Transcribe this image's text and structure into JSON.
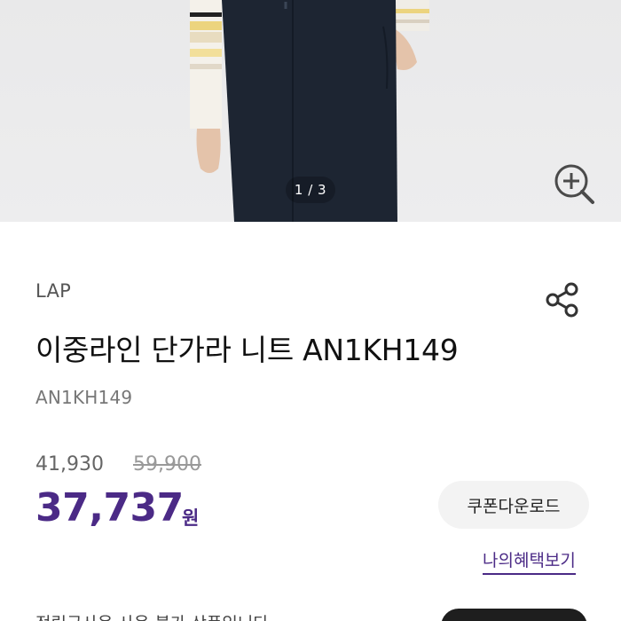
{
  "gallery": {
    "indicator": "1 / 3",
    "current_page": 1,
    "total_pages": 3,
    "zoom_icon": "zoom-in-icon"
  },
  "product": {
    "brand": "LAP",
    "share_icon": "share-icon",
    "title": "이중라인 단가라 니트 AN1KH149",
    "code": "AN1KH149"
  },
  "price": {
    "original": "41,930",
    "list": "59,900",
    "sale": "37,737",
    "unit": "원"
  },
  "actions": {
    "coupon_label": "쿠폰다운로드",
    "benefits_label": "나의혜택보기"
  },
  "bottom": {
    "note": "적립금사용 사용 불가 상품입니다"
  },
  "colors": {
    "accent": "#4b2a86",
    "pants": "#1d2532",
    "background": "#ebebec"
  }
}
